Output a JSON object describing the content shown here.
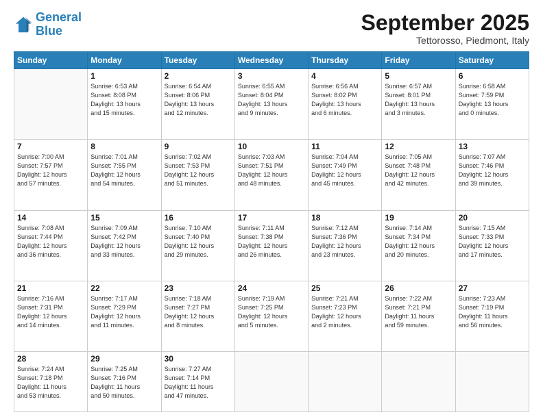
{
  "logo": {
    "line1": "General",
    "line2": "Blue"
  },
  "title": "September 2025",
  "subtitle": "Tettorosso, Piedmont, Italy",
  "days_of_week": [
    "Sunday",
    "Monday",
    "Tuesday",
    "Wednesday",
    "Thursday",
    "Friday",
    "Saturday"
  ],
  "weeks": [
    [
      {
        "day": "",
        "info": ""
      },
      {
        "day": "1",
        "info": "Sunrise: 6:53 AM\nSunset: 8:08 PM\nDaylight: 13 hours\nand 15 minutes."
      },
      {
        "day": "2",
        "info": "Sunrise: 6:54 AM\nSunset: 8:06 PM\nDaylight: 13 hours\nand 12 minutes."
      },
      {
        "day": "3",
        "info": "Sunrise: 6:55 AM\nSunset: 8:04 PM\nDaylight: 13 hours\nand 9 minutes."
      },
      {
        "day": "4",
        "info": "Sunrise: 6:56 AM\nSunset: 8:02 PM\nDaylight: 13 hours\nand 6 minutes."
      },
      {
        "day": "5",
        "info": "Sunrise: 6:57 AM\nSunset: 8:01 PM\nDaylight: 13 hours\nand 3 minutes."
      },
      {
        "day": "6",
        "info": "Sunrise: 6:58 AM\nSunset: 7:59 PM\nDaylight: 13 hours\nand 0 minutes."
      }
    ],
    [
      {
        "day": "7",
        "info": "Sunrise: 7:00 AM\nSunset: 7:57 PM\nDaylight: 12 hours\nand 57 minutes."
      },
      {
        "day": "8",
        "info": "Sunrise: 7:01 AM\nSunset: 7:55 PM\nDaylight: 12 hours\nand 54 minutes."
      },
      {
        "day": "9",
        "info": "Sunrise: 7:02 AM\nSunset: 7:53 PM\nDaylight: 12 hours\nand 51 minutes."
      },
      {
        "day": "10",
        "info": "Sunrise: 7:03 AM\nSunset: 7:51 PM\nDaylight: 12 hours\nand 48 minutes."
      },
      {
        "day": "11",
        "info": "Sunrise: 7:04 AM\nSunset: 7:49 PM\nDaylight: 12 hours\nand 45 minutes."
      },
      {
        "day": "12",
        "info": "Sunrise: 7:05 AM\nSunset: 7:48 PM\nDaylight: 12 hours\nand 42 minutes."
      },
      {
        "day": "13",
        "info": "Sunrise: 7:07 AM\nSunset: 7:46 PM\nDaylight: 12 hours\nand 39 minutes."
      }
    ],
    [
      {
        "day": "14",
        "info": "Sunrise: 7:08 AM\nSunset: 7:44 PM\nDaylight: 12 hours\nand 36 minutes."
      },
      {
        "day": "15",
        "info": "Sunrise: 7:09 AM\nSunset: 7:42 PM\nDaylight: 12 hours\nand 33 minutes."
      },
      {
        "day": "16",
        "info": "Sunrise: 7:10 AM\nSunset: 7:40 PM\nDaylight: 12 hours\nand 29 minutes."
      },
      {
        "day": "17",
        "info": "Sunrise: 7:11 AM\nSunset: 7:38 PM\nDaylight: 12 hours\nand 26 minutes."
      },
      {
        "day": "18",
        "info": "Sunrise: 7:12 AM\nSunset: 7:36 PM\nDaylight: 12 hours\nand 23 minutes."
      },
      {
        "day": "19",
        "info": "Sunrise: 7:14 AM\nSunset: 7:34 PM\nDaylight: 12 hours\nand 20 minutes."
      },
      {
        "day": "20",
        "info": "Sunrise: 7:15 AM\nSunset: 7:33 PM\nDaylight: 12 hours\nand 17 minutes."
      }
    ],
    [
      {
        "day": "21",
        "info": "Sunrise: 7:16 AM\nSunset: 7:31 PM\nDaylight: 12 hours\nand 14 minutes."
      },
      {
        "day": "22",
        "info": "Sunrise: 7:17 AM\nSunset: 7:29 PM\nDaylight: 12 hours\nand 11 minutes."
      },
      {
        "day": "23",
        "info": "Sunrise: 7:18 AM\nSunset: 7:27 PM\nDaylight: 12 hours\nand 8 minutes."
      },
      {
        "day": "24",
        "info": "Sunrise: 7:19 AM\nSunset: 7:25 PM\nDaylight: 12 hours\nand 5 minutes."
      },
      {
        "day": "25",
        "info": "Sunrise: 7:21 AM\nSunset: 7:23 PM\nDaylight: 12 hours\nand 2 minutes."
      },
      {
        "day": "26",
        "info": "Sunrise: 7:22 AM\nSunset: 7:21 PM\nDaylight: 11 hours\nand 59 minutes."
      },
      {
        "day": "27",
        "info": "Sunrise: 7:23 AM\nSunset: 7:19 PM\nDaylight: 11 hours\nand 56 minutes."
      }
    ],
    [
      {
        "day": "28",
        "info": "Sunrise: 7:24 AM\nSunset: 7:18 PM\nDaylight: 11 hours\nand 53 minutes."
      },
      {
        "day": "29",
        "info": "Sunrise: 7:25 AM\nSunset: 7:16 PM\nDaylight: 11 hours\nand 50 minutes."
      },
      {
        "day": "30",
        "info": "Sunrise: 7:27 AM\nSunset: 7:14 PM\nDaylight: 11 hours\nand 47 minutes."
      },
      {
        "day": "",
        "info": ""
      },
      {
        "day": "",
        "info": ""
      },
      {
        "day": "",
        "info": ""
      },
      {
        "day": "",
        "info": ""
      }
    ]
  ]
}
